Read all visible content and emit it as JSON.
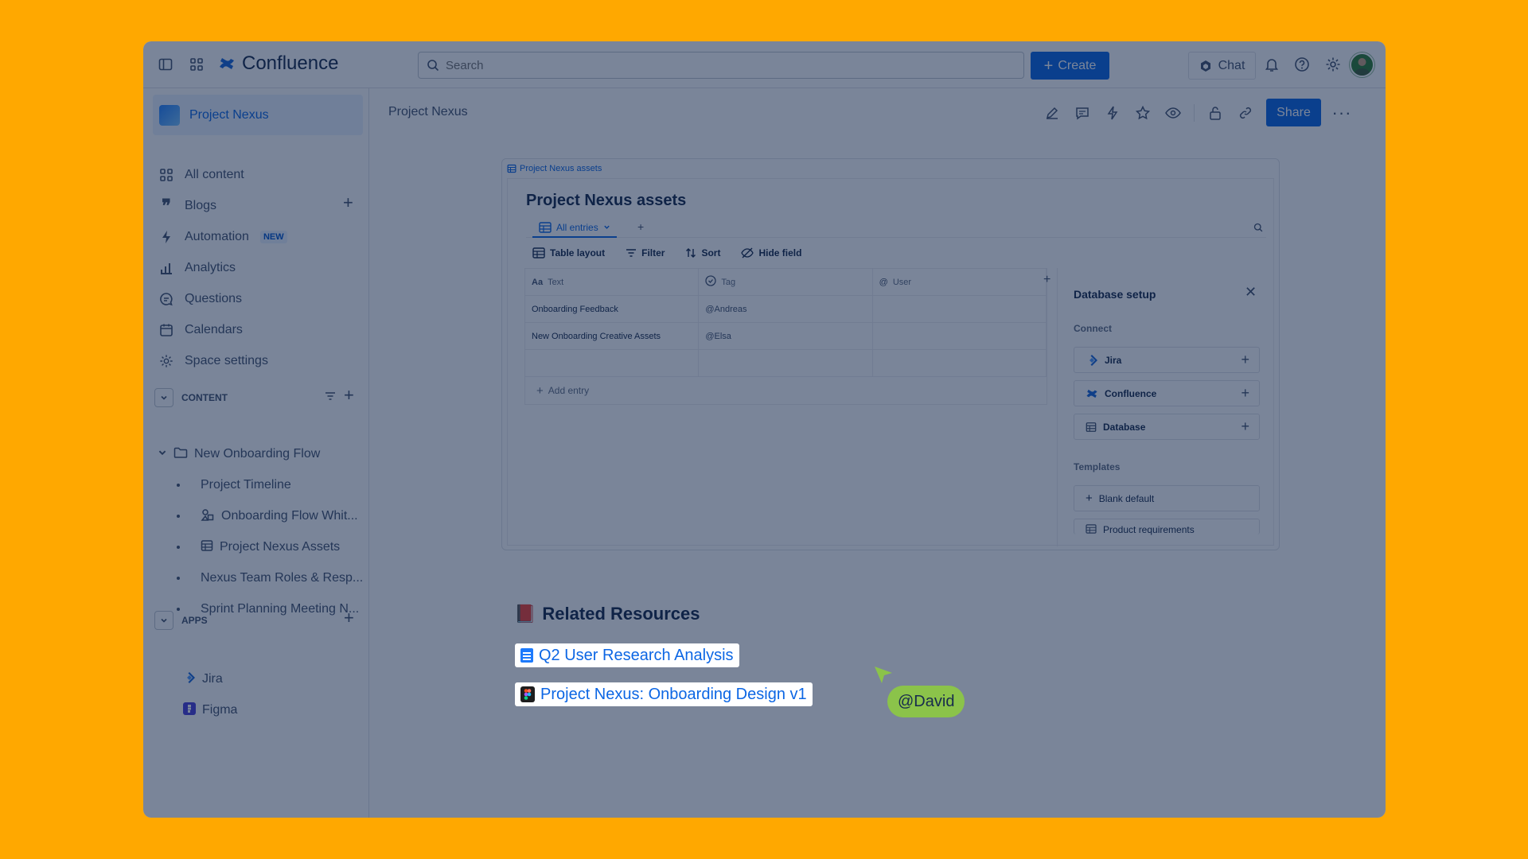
{
  "app": {
    "name": "Confluence",
    "search_placeholder": "Search",
    "create_label": "Create",
    "chat_label": "Chat"
  },
  "sidebar": {
    "space_name": "Project Nexus",
    "nav": [
      {
        "label": "All content"
      },
      {
        "label": "Blogs"
      },
      {
        "label": "Automation",
        "badge": "NEW"
      },
      {
        "label": "Analytics"
      },
      {
        "label": "Questions"
      },
      {
        "label": "Calendars"
      },
      {
        "label": "Space settings"
      }
    ],
    "content_header": "CONTENT",
    "tree": {
      "folder": "New Onboarding Flow",
      "children": [
        {
          "label": "Project Timeline"
        },
        {
          "label": "Onboarding Flow Whit..."
        },
        {
          "label": "Project Nexus Assets"
        },
        {
          "label": "Nexus Team Roles & Resp..."
        },
        {
          "label": "Sprint Planning Meeting N..."
        }
      ]
    },
    "apps_header": "APPS",
    "apps": [
      {
        "label": "Jira"
      },
      {
        "label": "Figma"
      }
    ]
  },
  "page": {
    "breadcrumb": "Project Nexus",
    "share_label": "Share"
  },
  "database": {
    "link_label": "Project Nexus assets",
    "title": "Project Nexus assets",
    "tab": "All entries",
    "toolbar": {
      "layout": "Table layout",
      "filter": "Filter",
      "sort": "Sort",
      "hide": "Hide field"
    },
    "columns": [
      "Text",
      "Tag",
      "User"
    ],
    "rows": [
      {
        "text": "Onboarding Feedback",
        "tag": "@Andreas",
        "user": ""
      },
      {
        "text": "New Onboarding Creative Assets",
        "tag": "@Elsa",
        "user": ""
      },
      {
        "text": "",
        "tag": "",
        "user": ""
      }
    ],
    "add_entry": "Add entry",
    "panel": {
      "title": "Database setup",
      "connect_label": "Connect",
      "connectors": [
        "Jira",
        "Confluence",
        "Database"
      ],
      "templates_label": "Templates",
      "templates": [
        "Blank default",
        "Product requirements"
      ]
    }
  },
  "related": {
    "emoji": "📕",
    "title": "Related Resources",
    "links": [
      {
        "label": "Q2 User Research Analysis"
      },
      {
        "label": "Project Nexus: Onboarding Design v1"
      }
    ]
  },
  "cursor": {
    "label": "@David",
    "color": "#8BC34A"
  },
  "colors": {
    "background": "#FFA800",
    "primary": "#0C66E4"
  }
}
